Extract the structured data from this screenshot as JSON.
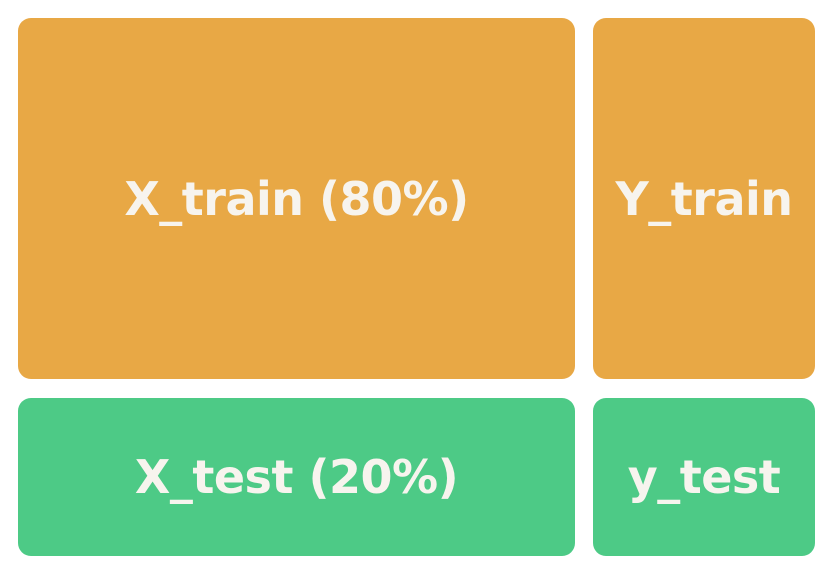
{
  "blocks": {
    "x_train": {
      "label": "X_train (80%)",
      "color": "#e8a845"
    },
    "y_train": {
      "label": "Y_train",
      "color": "#e8a845"
    },
    "x_test": {
      "label": "X_test (20%)",
      "color": "#4dca86"
    },
    "y_test": {
      "label": "y_test",
      "color": "#4dca86"
    }
  }
}
